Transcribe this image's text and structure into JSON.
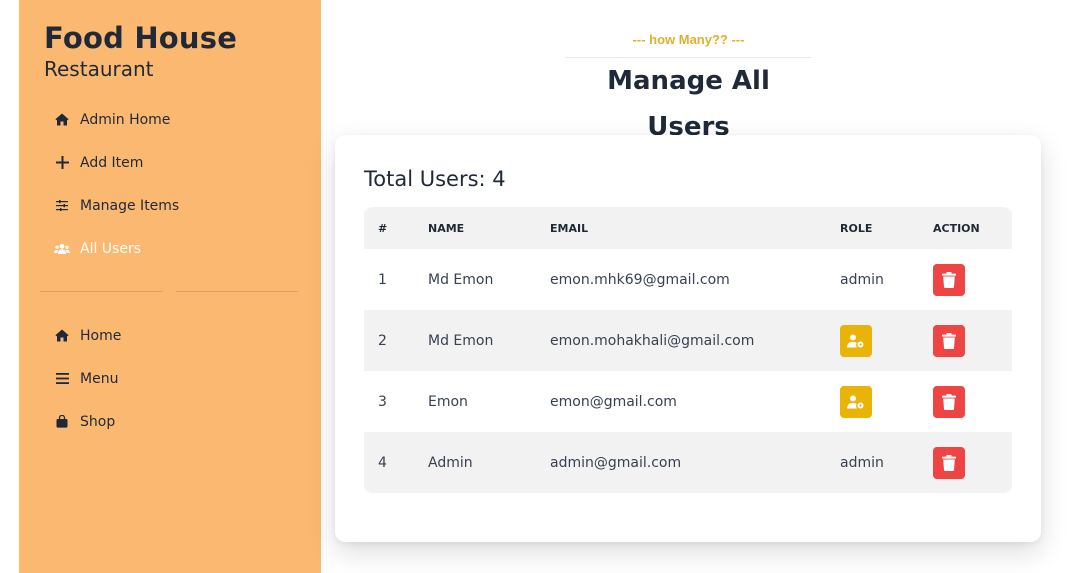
{
  "colors": {
    "sidebar_bg": "#fbb870",
    "accent": "#e0b02d",
    "delete": "#ef4444",
    "make_admin": "#e9b308"
  },
  "brand": {
    "title": "Food House",
    "subtitle": "Restaurant"
  },
  "nav_admin": [
    {
      "label": "Admin Home",
      "icon": "home-icon"
    },
    {
      "label": "Add Item",
      "icon": "plus-icon"
    },
    {
      "label": "Manage Items",
      "icon": "sliders-icon"
    },
    {
      "label": "All Users",
      "icon": "users-icon",
      "active": true
    }
  ],
  "nav_main": [
    {
      "label": "Home",
      "icon": "home-icon"
    },
    {
      "label": "Menu",
      "icon": "bars-icon"
    },
    {
      "label": "Shop",
      "icon": "shopping-bag-icon"
    }
  ],
  "header": {
    "kicker": "--- how Many?? ---",
    "title": "Manage All Users"
  },
  "card": {
    "total": "Total Users: 4"
  },
  "table": {
    "columns": [
      "#",
      "NAME",
      "EMAIL",
      "ROLE",
      "ACTION"
    ],
    "rows": [
      {
        "num": "1",
        "name": "Md Emon",
        "email": "emon.mhk69@gmail.com",
        "role": "admin"
      },
      {
        "num": "2",
        "name": "Md Emon",
        "email": "emon.mohakhali@gmail.com",
        "role": "",
        "role_icon": "user-cog-icon"
      },
      {
        "num": "3",
        "name": "Emon",
        "email": "emon@gmail.com",
        "role": "",
        "role_icon": "user-cog-icon"
      },
      {
        "num": "4",
        "name": "Admin",
        "email": "admin@gmail.com",
        "role": "admin"
      }
    ]
  }
}
